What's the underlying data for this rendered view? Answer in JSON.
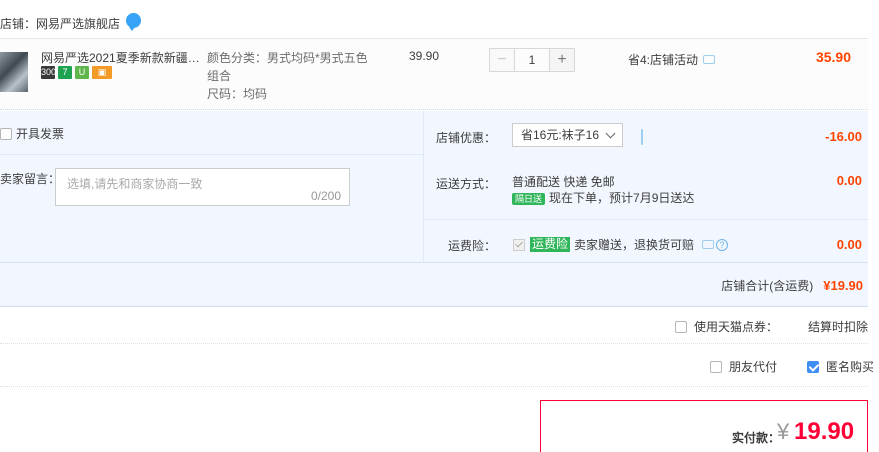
{
  "shop": {
    "label": "店铺：网易严选旗舰店"
  },
  "item": {
    "title": "网易严选2021夏季新款新疆精...",
    "badges": [
      "300",
      "7",
      "U",
      "▣"
    ],
    "sku_color": "颜色分类：男式均码*男式五色组合",
    "sku_size": "尺码：均码",
    "price": "39.90",
    "qty_minus": "−",
    "qty": "1",
    "qty_plus": "+",
    "promo": "省4:店铺活动",
    "total": "35.90"
  },
  "options": {
    "invoice_label": "开具发票",
    "memo_label": "卖家留言：",
    "memo_placeholder": "选填,请先和商家协商一致",
    "memo_count": "0/200",
    "coupon_label": "店铺优惠：",
    "coupon_value": "省16元:袜子16",
    "coupon_amount": "-16.00",
    "ship_label": "运送方式：",
    "ship_method": "普通配送 快递 免邮",
    "ship_tag": "隔日送",
    "ship_eta": "现在下单，预计7月9日送达",
    "ship_amount": "0.00",
    "ins_label": "运费险：",
    "ins_tag": "运费险",
    "ins_text": "卖家赠送，退换货可赔",
    "ins_amount": "0.00",
    "shop_total_label": "店铺合计(含运费)",
    "shop_total_value": "¥19.90"
  },
  "tmall": {
    "label": "使用天猫点券：",
    "note": "结算时扣除"
  },
  "friend_pay": {
    "label": "朋友代付"
  },
  "anonymous": {
    "label": "匿名购买"
  },
  "pay": {
    "label": "实付款：",
    "currency": "¥",
    "value": "19.90"
  },
  "colors": {
    "accent": "#ff0036",
    "price_red": "#ff4400",
    "panel_blue": "#f2f7ff"
  }
}
